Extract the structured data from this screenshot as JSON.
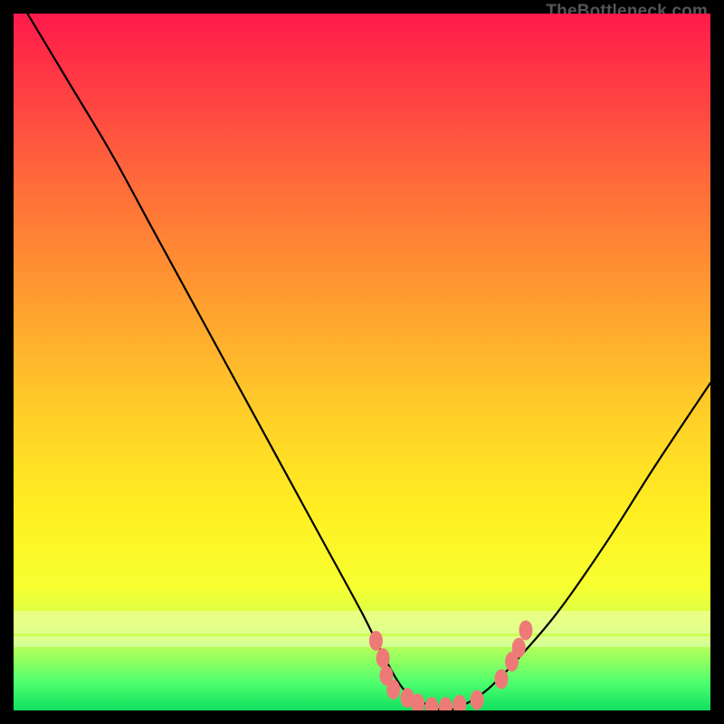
{
  "watermark": "TheBottleneck.com",
  "chart_data": {
    "type": "line",
    "title": "",
    "xlabel": "",
    "ylabel": "",
    "xlim": [
      0,
      100
    ],
    "ylim": [
      0,
      100
    ],
    "grid": false,
    "legend": false,
    "series": [
      {
        "name": "bottleneck-curve",
        "x": [
          2,
          8,
          14,
          20,
          26,
          32,
          38,
          44,
          50,
          53,
          56,
          59,
          62,
          65,
          68,
          72,
          78,
          85,
          92,
          100
        ],
        "y": [
          100,
          90,
          80,
          69,
          58,
          47,
          36,
          25,
          14,
          8,
          3,
          1,
          0,
          1,
          3,
          7,
          14,
          24,
          35,
          47
        ]
      }
    ],
    "markers": {
      "name": "highlight-dots",
      "color": "#ee7a78",
      "points": [
        {
          "x": 52.0,
          "y": 10.0
        },
        {
          "x": 53.0,
          "y": 7.5
        },
        {
          "x": 53.5,
          "y": 5.0
        },
        {
          "x": 54.5,
          "y": 3.0
        },
        {
          "x": 56.5,
          "y": 1.8
        },
        {
          "x": 58.0,
          "y": 1.0
        },
        {
          "x": 60.0,
          "y": 0.5
        },
        {
          "x": 62.0,
          "y": 0.5
        },
        {
          "x": 64.0,
          "y": 0.8
        },
        {
          "x": 66.5,
          "y": 1.5
        },
        {
          "x": 70.0,
          "y": 4.5
        },
        {
          "x": 71.5,
          "y": 7.0
        },
        {
          "x": 72.5,
          "y": 9.0
        },
        {
          "x": 73.5,
          "y": 11.5
        }
      ]
    },
    "bands": [
      {
        "name": "pale-band-1",
        "y": 13.5,
        "height": 3.2,
        "color": "rgba(255,255,255,0.35)"
      },
      {
        "name": "pale-band-2",
        "y": 10.3,
        "height": 1.6,
        "color": "rgba(255,255,255,0.35)"
      }
    ],
    "gradient_stops": [
      {
        "pos": 0,
        "color": "#ff1a4a"
      },
      {
        "pos": 10,
        "color": "#ff3b44"
      },
      {
        "pos": 24,
        "color": "#ff6a3a"
      },
      {
        "pos": 40,
        "color": "#ff9a30"
      },
      {
        "pos": 58,
        "color": "#ffd028"
      },
      {
        "pos": 72,
        "color": "#fff022"
      },
      {
        "pos": 82,
        "color": "#f7ff30"
      },
      {
        "pos": 90,
        "color": "#c8ff55"
      },
      {
        "pos": 96,
        "color": "#4eff6e"
      },
      {
        "pos": 100,
        "color": "#10e060"
      }
    ]
  }
}
